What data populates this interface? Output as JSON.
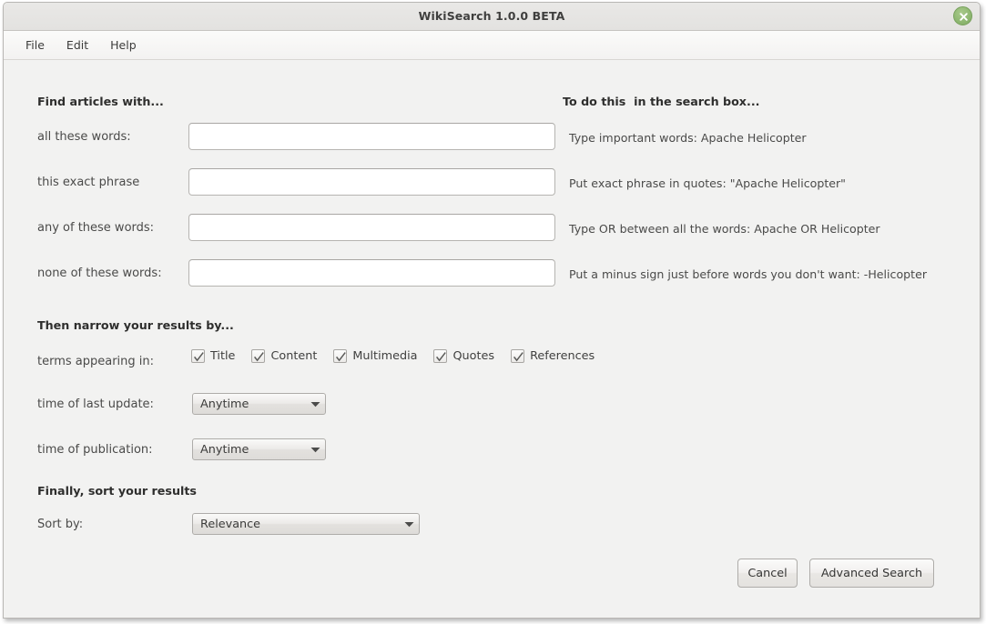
{
  "window": {
    "title": "WikiSearch 1.0.0 BETA",
    "close_icon": "close-circle-icon"
  },
  "menubar": {
    "items": [
      {
        "label": "File"
      },
      {
        "label": "Edit"
      },
      {
        "label": "Help"
      }
    ]
  },
  "find_section": {
    "heading": "Find articles with...",
    "hint_heading": "To do this  in the search box...",
    "rows": [
      {
        "label": "all these words:",
        "value": "",
        "placeholder": "",
        "hint": "Type important words: Apache Helicopter"
      },
      {
        "label": "this exact phrase",
        "value": "",
        "placeholder": "",
        "hint": "Put exact phrase in quotes: \"Apache Helicopter\""
      },
      {
        "label": "any of these words:",
        "value": "",
        "placeholder": "",
        "hint": "Type OR between all the words: Apache OR Helicopter"
      },
      {
        "label": "none of these words:",
        "value": "",
        "placeholder": "",
        "hint": "Put a minus sign just before words you don't want: -Helicopter"
      }
    ]
  },
  "narrow_section": {
    "heading": "Then narrow your results by...",
    "terms_label": "terms appearing in:",
    "checkboxes": [
      {
        "label": "Title",
        "checked": true
      },
      {
        "label": "Content",
        "checked": true
      },
      {
        "label": "Multimedia",
        "checked": true
      },
      {
        "label": "Quotes",
        "checked": true
      },
      {
        "label": "References",
        "checked": true
      }
    ],
    "last_update_label": "time of last update:",
    "last_update_value": "Anytime",
    "publication_label": "time of publication:",
    "publication_value": "Anytime"
  },
  "sort_section": {
    "heading": "Finally, sort your results",
    "sort_label": "Sort by:",
    "sort_value": "Relevance"
  },
  "actions": {
    "cancel_label": "Cancel",
    "advanced_search_label": "Advanced Search"
  },
  "colors": {
    "window_bg": "#f2f2f1",
    "titlebar_bg": "#e6e5e3",
    "close_button": "#90b973",
    "text": "#3f3f3e"
  }
}
